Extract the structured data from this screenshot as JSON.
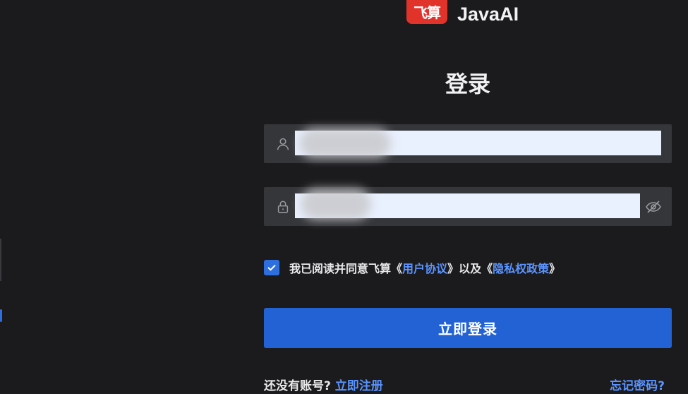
{
  "brand": {
    "badge_text": "飞算",
    "name": "JavaAI",
    "badge_color": "#e2332b"
  },
  "title": "登录",
  "username_field": {
    "value": "",
    "icon": "user-icon"
  },
  "password_field": {
    "value": "",
    "icon": "lock-icon",
    "toggle_icon": "eye-off-icon"
  },
  "agreement": {
    "checked": true,
    "prefix": "我已阅读并同意飞算",
    "open1": "《",
    "link1": "用户协议",
    "close1": "》",
    "middle": "以及",
    "open2": "《",
    "link2": "隐私权政策",
    "close2": "》"
  },
  "login_button": "立即登录",
  "register": {
    "prompt": "还没有账号?",
    "link": "立即注册"
  },
  "forgot_password": "忘记密码?",
  "colors": {
    "background": "#1b1b1e",
    "input_bg": "#34363a",
    "autofill_bg": "#e9f0fe",
    "primary": "#2262d4",
    "link": "#5b94ff"
  }
}
